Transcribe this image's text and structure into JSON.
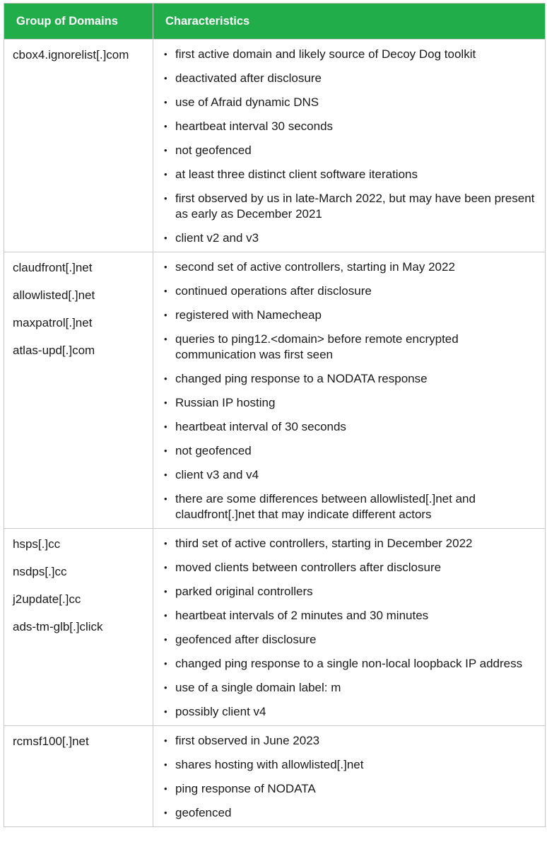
{
  "table": {
    "headers": [
      "Group of Domains",
      "Characteristics"
    ],
    "header_color": "#22ad4b",
    "rows": [
      {
        "domains": [
          "cbox4.ignorelist[.]com"
        ],
        "characteristics": [
          "first active domain and likely source of Decoy Dog toolkit",
          "deactivated after disclosure",
          "use of Afraid dynamic DNS",
          "heartbeat interval 30 seconds",
          "not geofenced",
          "at least three distinct client software iterations",
          "first observed by us in late-March 2022, but may have been present as early as December 2021",
          "client v2 and v3"
        ]
      },
      {
        "domains": [
          "claudfront[.]net",
          "allowlisted[.]net",
          "maxpatrol[.]net",
          "atlas-upd[.]com"
        ],
        "characteristics": [
          "second set of active controllers, starting in May 2022",
          "continued operations after disclosure",
          "registered with Namecheap",
          "queries to ping12.<domain> before remote encrypted communication was first seen",
          "changed ping response to a NODATA response",
          "Russian IP hosting",
          "heartbeat interval of 30 seconds",
          "not geofenced",
          "client v3 and v4",
          "there are some differences between allowlisted[.]net and claudfront[.]net that may indicate different actors"
        ]
      },
      {
        "domains": [
          "hsps[.]cc",
          "nsdps[.]cc",
          "j2update[.]cc",
          "ads-tm-glb[.]click"
        ],
        "characteristics": [
          "third set of active controllers, starting in December 2022",
          "moved clients between controllers after disclosure",
          "parked original controllers",
          "heartbeat intervals of 2 minutes and 30 minutes",
          "geofenced after disclosure",
          "changed ping response to a single non-local loopback IP address",
          "use of a single domain label: m",
          "possibly client v4"
        ]
      },
      {
        "domains": [
          "rcmsf100[.]net"
        ],
        "characteristics": [
          "first observed in June 2023",
          "shares hosting with allowlisted[.]net",
          "ping response of NODATA",
          "geofenced"
        ]
      }
    ]
  }
}
